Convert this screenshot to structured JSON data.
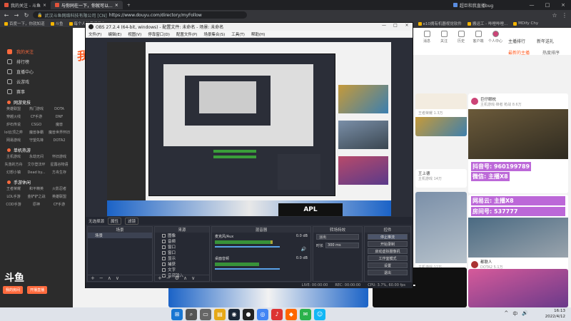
{
  "browser": {
    "tabs": [
      {
        "label": "我的关注 - 斗鱼",
        "active": false
      },
      {
        "label": "与你同在一下，你就可以...",
        "active": true
      }
    ],
    "tab_right": "超巨和我直播bug",
    "url": "https://www.douyu.com/directory/myFollow",
    "url_secure_label": "武汉斗鱼网络科技有限公司 [CN]",
    "bookmarks": [
      "百度一下，你就知道",
      "斗鱼",
      "每个人的直播平台",
      "Gmail",
      "YouTube",
      "翻译",
      "Gas Dashboard",
      "e10拥有机器视觉软件",
      "搬运工 - 哔哩哔哩...",
      "MDify Chy",
      "其他书签"
    ]
  },
  "douyu": {
    "sidebar_top": [
      {
        "label": "我的关注",
        "active": true
      },
      {
        "label": "排行榜",
        "active": false
      },
      {
        "label": "直播中心",
        "active": false
      },
      {
        "label": "云游戏",
        "active": false
      },
      {
        "label": "赛事",
        "active": false
      }
    ],
    "section_hot": "网游竞技",
    "hot_games": [
      "英雄联盟",
      "热门游戏",
      "DOTA",
      "穿越火线",
      "CF手游",
      "DNF",
      "炉石传说",
      "CSGO",
      "魔兽",
      "lol云顶之弈",
      "魔兽争霸",
      "魔兽世界怀旧",
      "网易游戏",
      "守望先锋",
      "DOTA2",
      "和平精英",
      "APEX英雄"
    ],
    "section_mobile": "单机热游",
    "mobile_games": [
      "主机游戏",
      "永劫无间",
      "怀旧游戏",
      "失落的方舟",
      "艾尔登法环",
      "星露谷物语",
      "幻想小镇",
      "Dead by...",
      "方舟生存"
    ],
    "section_hand": "手游休闲",
    "hand_games": [
      "王者荣耀",
      "和平精英",
      "火影忍者",
      "LOL手游",
      "金铲铲之战",
      "英雄联盟",
      "COD手游",
      "原神",
      "CF手游",
      "阴阳师",
      "第五人格",
      "明日方舟"
    ],
    "logo": "斗鱼",
    "sidebar_buttons": [
      "我的房间",
      "开播直播"
    ],
    "follow_title": "我",
    "header_icons": [
      "消息",
      "关注",
      "历史",
      "客户端",
      "个人中心"
    ],
    "header_right": [
      "主播排行",
      "鲨鱼",
      "新年送礼"
    ],
    "header_tabs": [
      "最新的主播",
      "热度排序"
    ],
    "cards": [
      {
        "name": "巨仔眼枕",
        "sub": "主机游戏·锋者 枪战 8.6万"
      },
      {
        "name": "斗鱼不乖",
        "sub": "王者荣耀 1.3万"
      },
      {
        "name": "王上德",
        "sub": "主机游戏 14万"
      },
      {
        "name": "酸辣鸡",
        "sub": "主机游戏 12万"
      },
      {
        "name": "桥弟",
        "sub": "穿越火线 1.7万"
      },
      {
        "name": "都联人",
        "sub": "DOTA2 5.1万"
      }
    ],
    "overlay_lines": [
      "抖音号: 960199789",
      "微信: 主播X8",
      "网易云: 主播X8",
      "房间号: 537777"
    ]
  },
  "obs": {
    "title": "OBS 27.2.4 (64-bit, windows) - 配置文件: 未命名 - 场景: 未命名",
    "menu": [
      "文件(F)",
      "编辑(E)",
      "视图(V)",
      "停靠窗口(D)",
      "配置文件(P)",
      "场景集合(S)",
      "工具(T)",
      "帮助(H)"
    ],
    "preview_bar": [
      "无选择源",
      "属性",
      "滤镜"
    ],
    "docks": {
      "scenes": {
        "title": "场景",
        "items": [
          "场景"
        ]
      },
      "sources": {
        "title": "来源",
        "items": [
          "图像",
          "音频",
          "窗口",
          "窗口",
          "显示",
          "捕获",
          "文字",
          "音频输入",
          "捕获",
          "图片"
        ]
      },
      "mixer": {
        "title": "混音器",
        "tracks": [
          {
            "name": "麦克风/Aux",
            "db": "0.0 dB",
            "level_pct": 62
          },
          {
            "name": "桌面音频",
            "db": "0.0 dB",
            "level_pct": 48
          }
        ]
      },
      "transitions": {
        "title": "转场特效",
        "type": "淡出",
        "duration_label": "时长",
        "duration": "300 ms"
      },
      "controls": {
        "title": "控件",
        "buttons": [
          "停止推流",
          "开始录制",
          "启动虚拟摄像机",
          "工作室模式",
          "设置",
          "退出"
        ]
      }
    },
    "status": [
      "LIVE: 00:00:00",
      "REC: 00:00:00",
      "CPU: 3.7%, 60.00 fps"
    ]
  },
  "taskbar": {
    "apps": [
      "开始",
      "搜索",
      "任务视图",
      "文件资源管理器",
      "Steam",
      "OBS",
      "Chrome",
      "网易云音乐",
      "斗鱼",
      "微信",
      "QQ"
    ],
    "time": "16:13",
    "date": "2022/4/12",
    "tray": [
      "^",
      "中",
      "🔊"
    ]
  },
  "colors": {
    "douyu_orange": "#ff5d23",
    "obs_bg": "#2b2e38",
    "browser_dark": "#202124"
  }
}
